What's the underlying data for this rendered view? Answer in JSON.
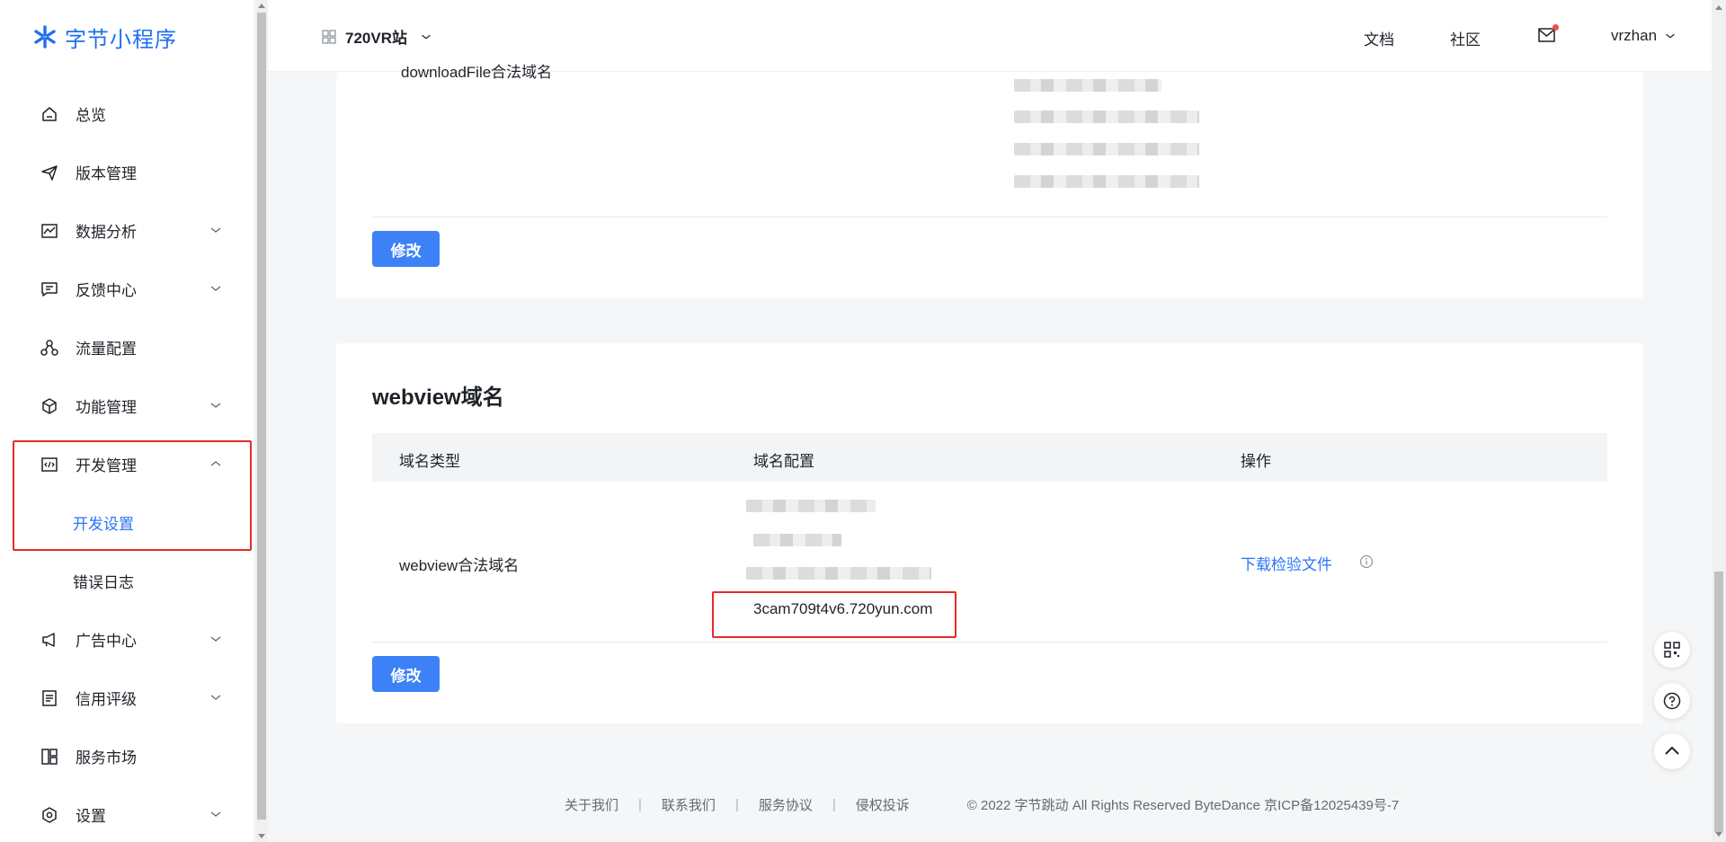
{
  "brand": {
    "logo_text": "字节小程序",
    "accent": "#1f6ff2"
  },
  "sidebar": {
    "items": [
      {
        "label": "总览",
        "icon": "home-icon",
        "expandable": false
      },
      {
        "label": "版本管理",
        "icon": "send-icon",
        "expandable": false
      },
      {
        "label": "数据分析",
        "icon": "chart-icon",
        "expandable": true
      },
      {
        "label": "反馈中心",
        "icon": "message-icon",
        "expandable": true
      },
      {
        "label": "流量配置",
        "icon": "flow-icon",
        "expandable": false
      },
      {
        "label": "功能管理",
        "icon": "cube-icon",
        "expandable": true
      },
      {
        "label": "开发管理",
        "icon": "code-icon",
        "expandable": true,
        "expanded": true,
        "children": [
          {
            "label": "开发设置",
            "active": true
          },
          {
            "label": "错误日志",
            "active": false
          }
        ]
      },
      {
        "label": "广告中心",
        "icon": "megaphone-icon",
        "expandable": true
      },
      {
        "label": "信用评级",
        "icon": "list-icon",
        "expandable": true
      },
      {
        "label": "服务市场",
        "icon": "layout-icon",
        "expandable": false
      },
      {
        "label": "设置",
        "icon": "settings-icon",
        "expandable": true
      }
    ]
  },
  "header": {
    "app_name": "720VR站",
    "links": [
      "文档",
      "社区"
    ],
    "mail_icon": "mail-icon",
    "user_name": "vrzhan"
  },
  "card1": {
    "row_label": "downloadFile合法域名",
    "modify_label": "修改"
  },
  "card2": {
    "title": "webview域名",
    "columns": [
      "域名类型",
      "域名配置",
      "操作"
    ],
    "row": {
      "type": "webview合法域名",
      "visible_domain": "3cam709t4v6.720yun.com",
      "action": "下载检验文件"
    },
    "modify_label": "修改"
  },
  "footer": {
    "links": [
      "关于我们",
      "联系我们",
      "服务协议",
      "侵权投诉"
    ],
    "copyright": "© 2022 字节跳动 All Rights Reserved ByteDance 京ICP备12025439号-7"
  },
  "colors": {
    "primary": "#3c82f6",
    "link": "#2b74f7",
    "highlight_box": "#e62a2a"
  }
}
